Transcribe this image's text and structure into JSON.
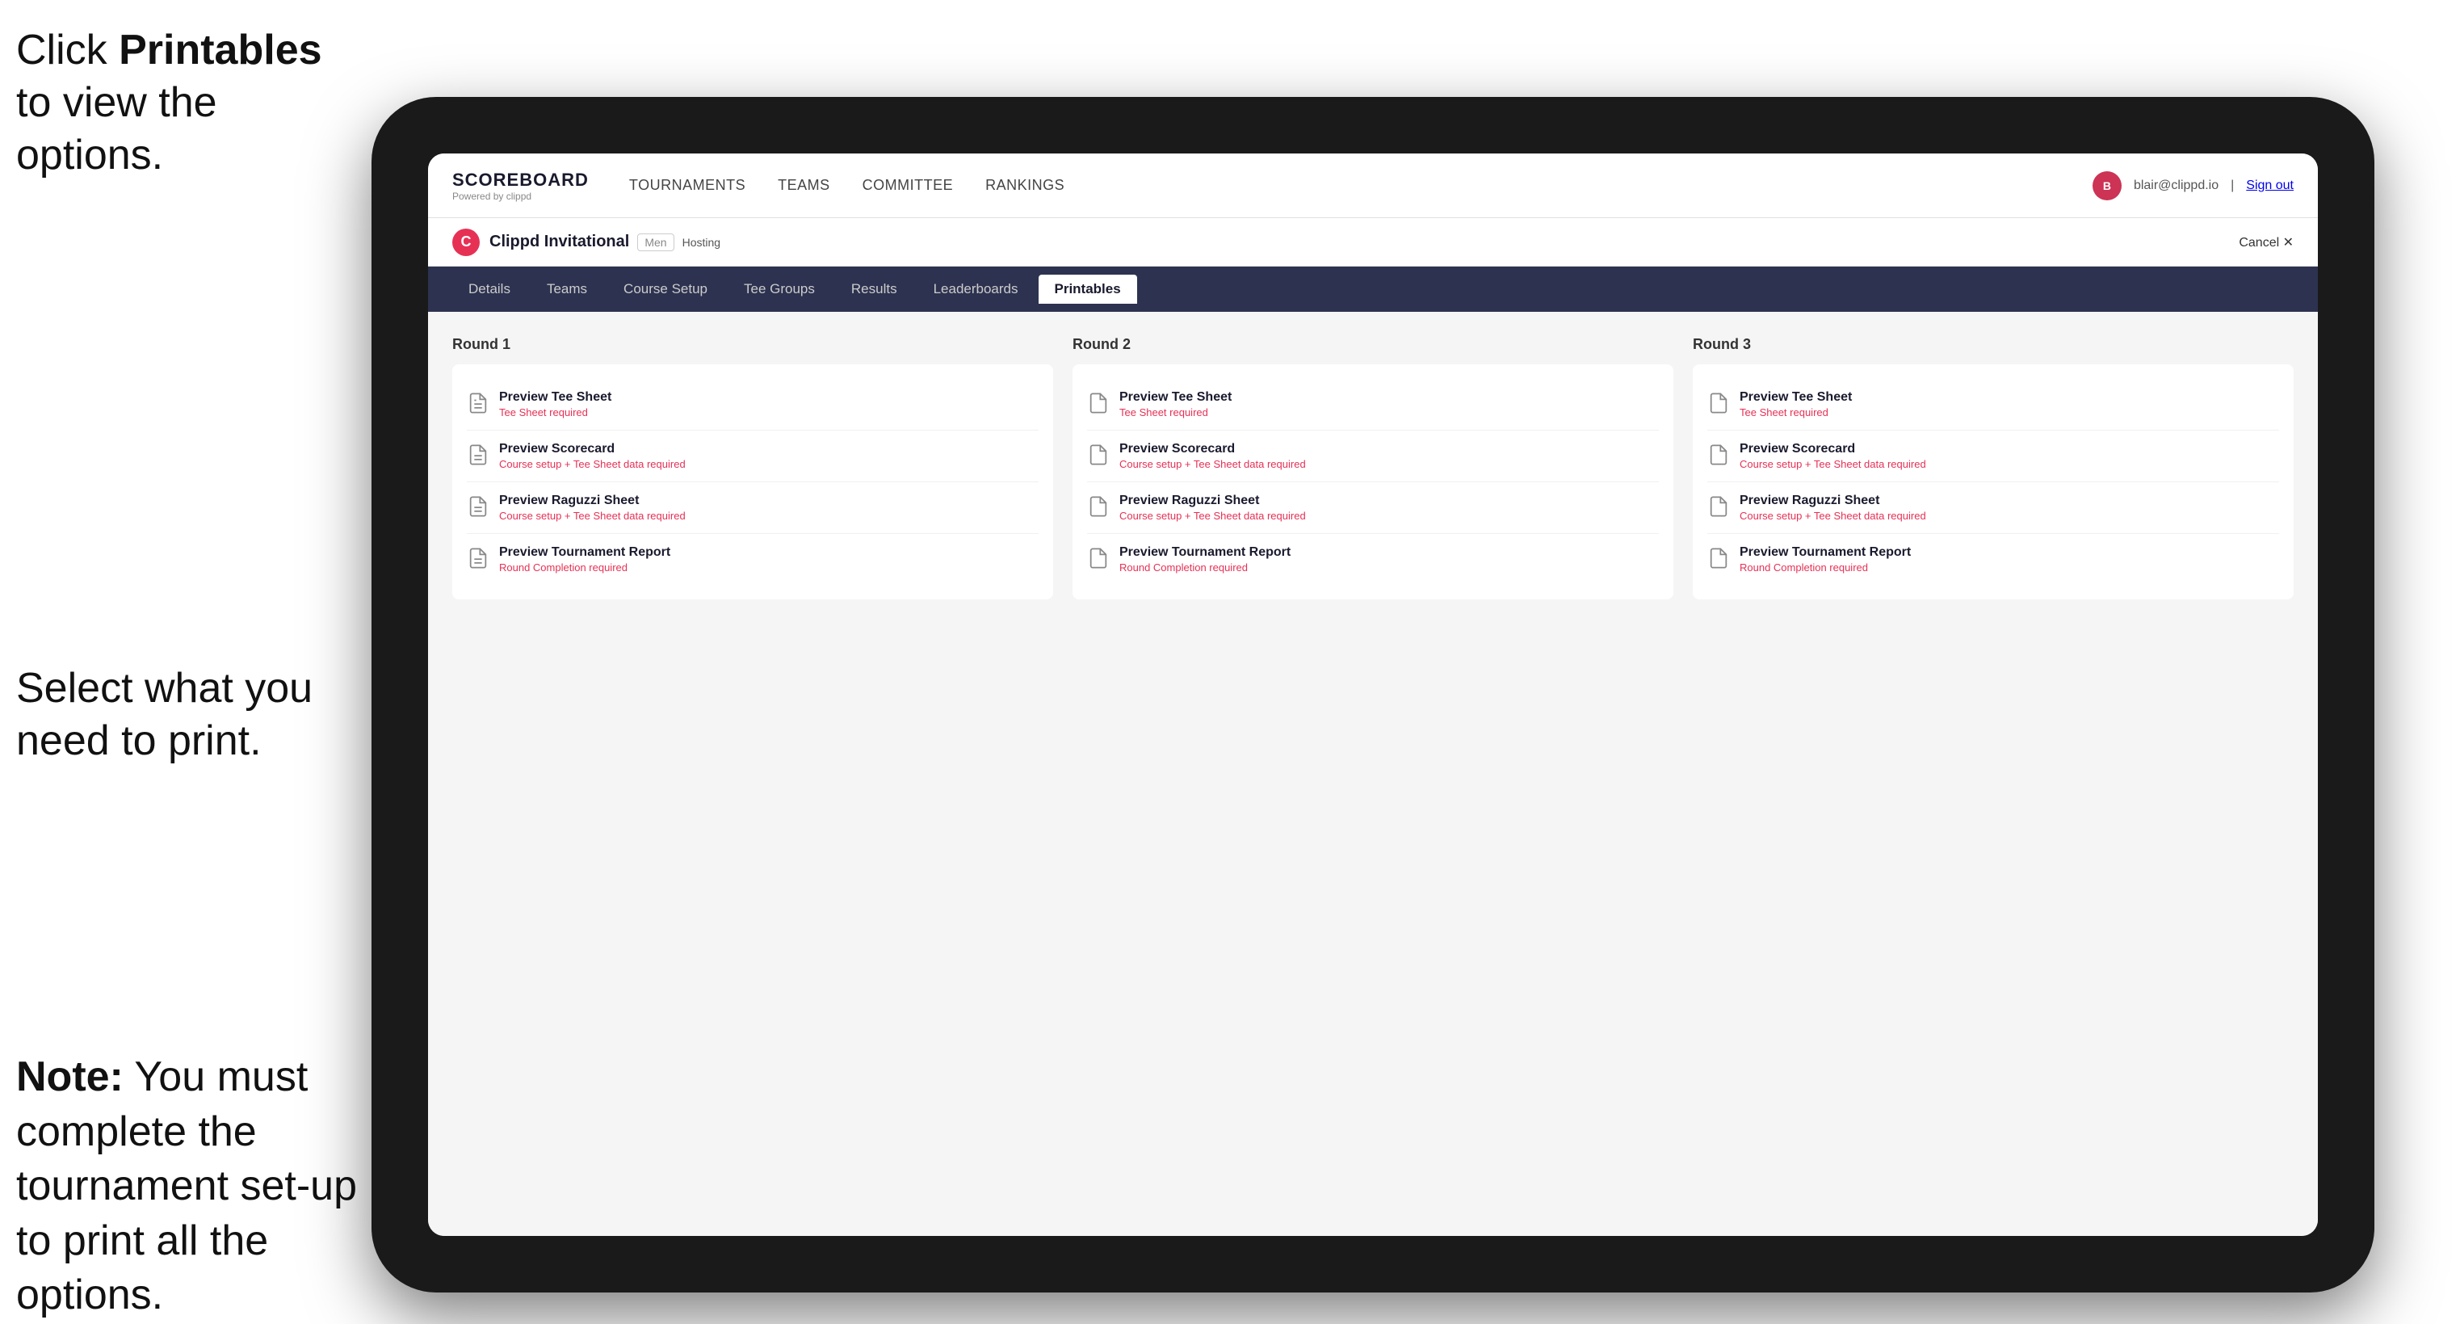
{
  "instructions": {
    "top": {
      "prefix": "Click ",
      "bold": "Printables",
      "suffix": " to view the options."
    },
    "middle": {
      "text": "Select what you need to print."
    },
    "bottom": {
      "bold": "Note:",
      "suffix": " You must complete the tournament set-up to print all the options."
    }
  },
  "app": {
    "logo_title": "SCOREBOARD",
    "logo_sub": "Powered by clippd",
    "nav_links": [
      {
        "label": "TOURNAMENTS",
        "active": false
      },
      {
        "label": "TEAMS",
        "active": false
      },
      {
        "label": "COMMITTEE",
        "active": false
      },
      {
        "label": "RANKINGS",
        "active": false
      }
    ],
    "user_email": "blair@clippd.io",
    "sign_out": "Sign out"
  },
  "tournament": {
    "initial": "C",
    "name": "Clippd Invitational",
    "badge": "Men",
    "status": "Hosting",
    "cancel": "Cancel ✕"
  },
  "tabs": [
    {
      "label": "Details",
      "active": false
    },
    {
      "label": "Teams",
      "active": false
    },
    {
      "label": "Course Setup",
      "active": false
    },
    {
      "label": "Tee Groups",
      "active": false
    },
    {
      "label": "Results",
      "active": false
    },
    {
      "label": "Leaderboards",
      "active": false
    },
    {
      "label": "Printables",
      "active": true
    }
  ],
  "rounds": [
    {
      "title": "Round 1",
      "items": [
        {
          "title": "Preview Tee Sheet",
          "subtitle": "Tee Sheet required"
        },
        {
          "title": "Preview Scorecard",
          "subtitle": "Course setup + Tee Sheet data required"
        },
        {
          "title": "Preview Raguzzi Sheet",
          "subtitle": "Course setup + Tee Sheet data required"
        },
        {
          "title": "Preview Tournament Report",
          "subtitle": "Round Completion required"
        }
      ]
    },
    {
      "title": "Round 2",
      "items": [
        {
          "title": "Preview Tee Sheet",
          "subtitle": "Tee Sheet required"
        },
        {
          "title": "Preview Scorecard",
          "subtitle": "Course setup + Tee Sheet data required"
        },
        {
          "title": "Preview Raguzzi Sheet",
          "subtitle": "Course setup + Tee Sheet data required"
        },
        {
          "title": "Preview Tournament Report",
          "subtitle": "Round Completion required"
        }
      ]
    },
    {
      "title": "Round 3",
      "items": [
        {
          "title": "Preview Tee Sheet",
          "subtitle": "Tee Sheet required"
        },
        {
          "title": "Preview Scorecard",
          "subtitle": "Course setup + Tee Sheet data required"
        },
        {
          "title": "Preview Raguzzi Sheet",
          "subtitle": "Course setup + Tee Sheet data required"
        },
        {
          "title": "Preview Tournament Report",
          "subtitle": "Round Completion required"
        }
      ]
    }
  ]
}
